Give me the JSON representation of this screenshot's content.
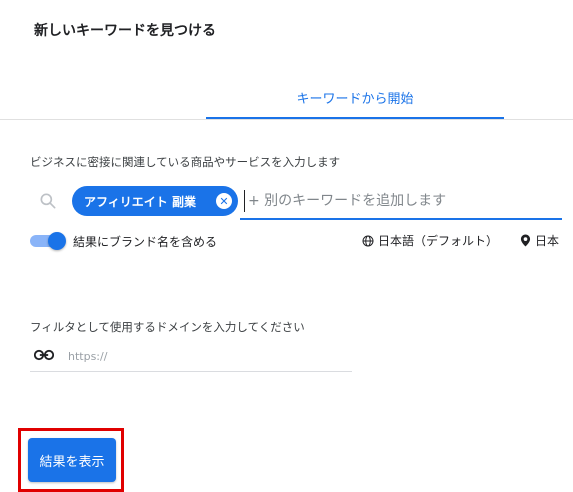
{
  "header": {
    "title": "新しいキーワードを見つける"
  },
  "tabs": [
    {
      "label": "キーワードから開始",
      "active": true
    }
  ],
  "keywords_section": {
    "instruction": "ビジネスに密接に関連している商品やサービスを入力します",
    "search_icon": "search-icon",
    "chips": [
      {
        "label": "アフィリエイト 副業",
        "close_icon": "close-circle-icon"
      }
    ],
    "input_placeholder": "+ 別のキーワードを追加します"
  },
  "brand_toggle": {
    "label": "結果にブランド名を含める",
    "on": true
  },
  "language": {
    "icon": "globe-icon",
    "label": "日本語（デフォルト）"
  },
  "location": {
    "icon": "location-pin-icon",
    "label": "日本"
  },
  "domain_section": {
    "label": "フィルタとして使用するドメインを入力してください",
    "icon": "link-icon",
    "placeholder": "https://"
  },
  "actions": {
    "submit_label": "結果を表示"
  },
  "colors": {
    "accent": "#1a73e8",
    "highlight": "#e00000"
  }
}
